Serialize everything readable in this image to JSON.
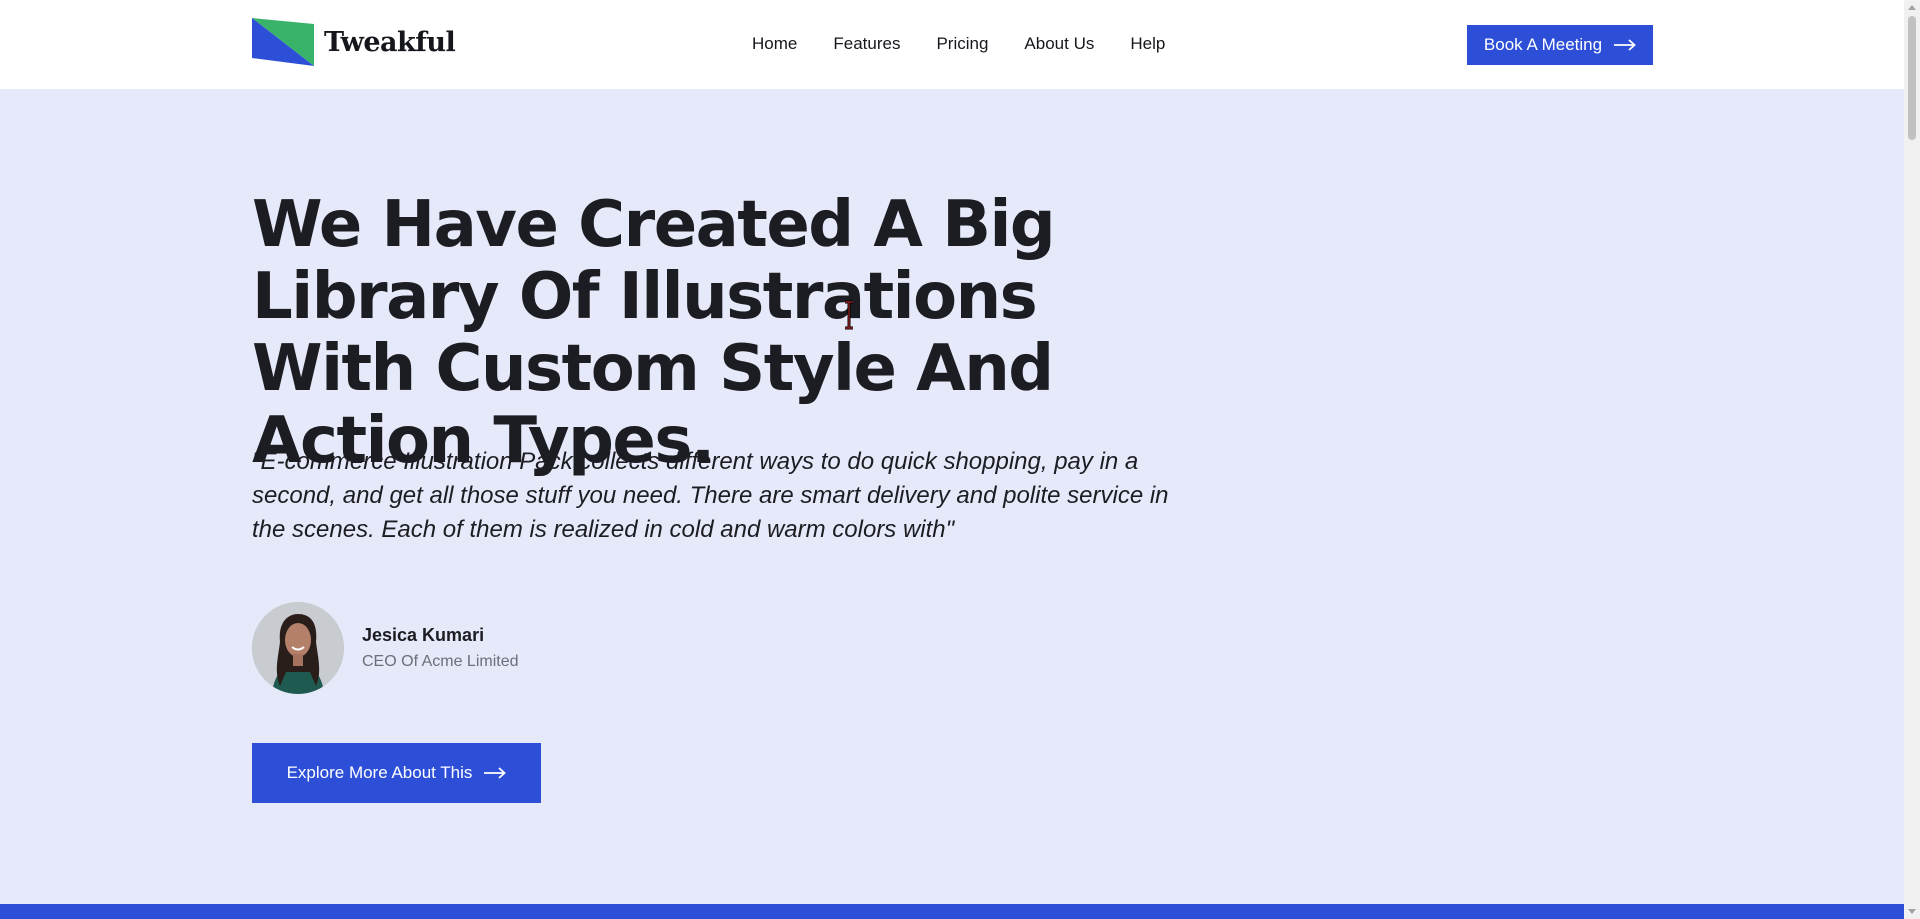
{
  "header": {
    "logo": {
      "text": "Tweakful",
      "icon": "tweakful-logo-icon"
    },
    "nav": [
      {
        "label": "Home"
      },
      {
        "label": "Features"
      },
      {
        "label": "Pricing"
      },
      {
        "label": "About Us"
      },
      {
        "label": "Help"
      }
    ],
    "cta": {
      "label": "Book A Meeting",
      "icon": "arrow-right-icon"
    }
  },
  "hero": {
    "headline": "We Have Created A Big Library Of Illustrations With Custom Style And Action Types.",
    "quote": "\"E-commerce Illustration Pack collects different ways to do quick shopping, pay in a second, and get all those stuff you need. There are smart delivery and polite service in the scenes. Each of them is realized in cold and warm colors with\"",
    "author": {
      "name": "Jesica Kumari",
      "role": "CEO Of Acme Limited"
    },
    "cta": {
      "label": "Explore More About This",
      "icon": "arrow-right-icon"
    }
  },
  "colors": {
    "accent": "#2d4fd8",
    "hero_background": "#e6e9f9",
    "logo_green": "#3ab36a",
    "text": "#1c1d22"
  }
}
